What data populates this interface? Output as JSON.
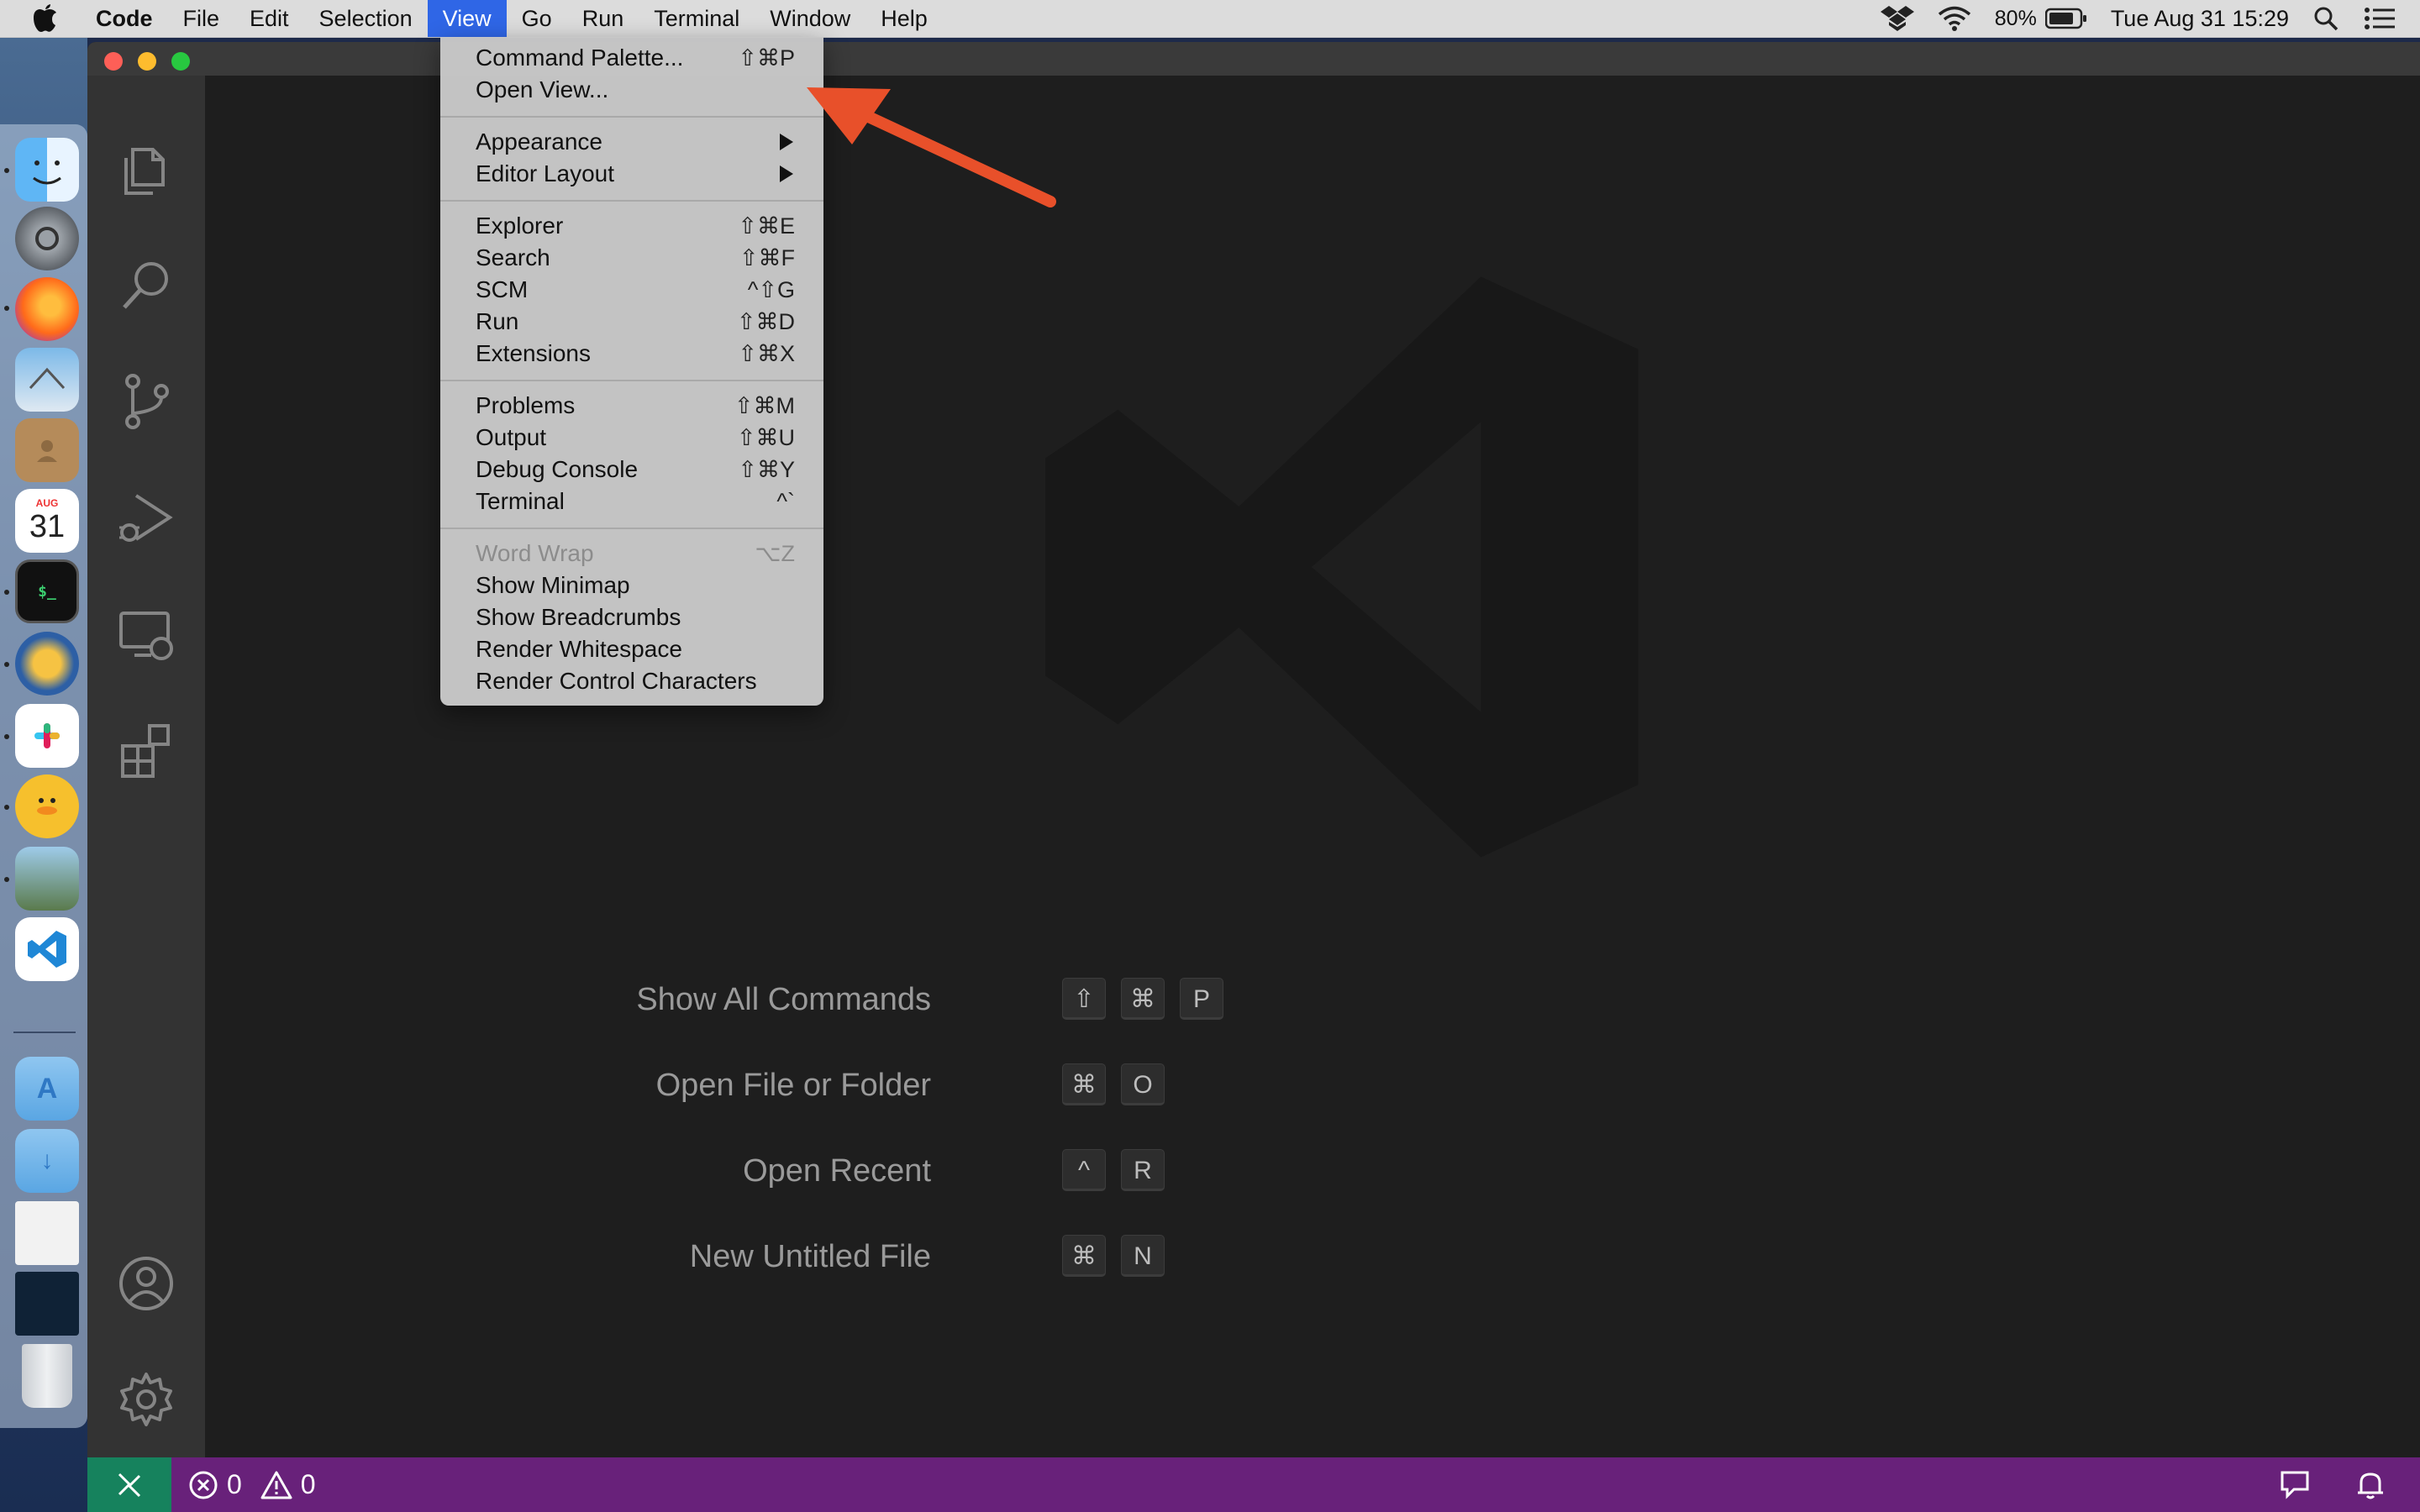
{
  "menubar": {
    "app_name": "Code",
    "items": [
      "File",
      "Edit",
      "Selection",
      "View",
      "Go",
      "Run",
      "Terminal",
      "Window",
      "Help"
    ],
    "active_item": "View",
    "battery_percent": "80%",
    "clock": "Tue Aug 31  15:29"
  },
  "view_menu": {
    "items": [
      {
        "label": "Command Palette...",
        "shortcut": "⇧⌘P"
      },
      {
        "label": "Open View...",
        "shortcut": ""
      },
      {
        "label": "Appearance",
        "shortcut": "",
        "submenu": true
      },
      {
        "label": "Editor Layout",
        "shortcut": "",
        "submenu": true
      },
      {
        "label": "Explorer",
        "shortcut": "⇧⌘E"
      },
      {
        "label": "Search",
        "shortcut": "⇧⌘F"
      },
      {
        "label": "SCM",
        "shortcut": "^⇧G"
      },
      {
        "label": "Run",
        "shortcut": "⇧⌘D"
      },
      {
        "label": "Extensions",
        "shortcut": "⇧⌘X"
      },
      {
        "label": "Problems",
        "shortcut": "⇧⌘M"
      },
      {
        "label": "Output",
        "shortcut": "⇧⌘U"
      },
      {
        "label": "Debug Console",
        "shortcut": "⇧⌘Y"
      },
      {
        "label": "Terminal",
        "shortcut": "^`"
      },
      {
        "label": "Word Wrap",
        "shortcut": "⌥Z",
        "disabled": true
      },
      {
        "label": "Show Minimap",
        "shortcut": ""
      },
      {
        "label": "Show Breadcrumbs",
        "shortcut": ""
      },
      {
        "label": "Render Whitespace",
        "shortcut": ""
      },
      {
        "label": "Render Control Characters",
        "shortcut": ""
      }
    ]
  },
  "welcome_shortcuts": [
    {
      "label": "Show All Commands",
      "keys": [
        "⇧",
        "⌘",
        "P"
      ]
    },
    {
      "label": "Open File or Folder",
      "keys": [
        "⌘",
        "O"
      ]
    },
    {
      "label": "Open Recent",
      "keys": [
        "^",
        "R"
      ]
    },
    {
      "label": "New Untitled File",
      "keys": [
        "⌘",
        "N"
      ]
    }
  ],
  "statusbar": {
    "errors": "0",
    "warnings": "0"
  },
  "dock": {
    "calendar_month": "AUG",
    "calendar_day": "31"
  },
  "colors": {
    "statusbar": "#68217a",
    "remote_indicator": "#16825d",
    "menu_highlight": "#2f66e6",
    "annotation_arrow": "#e8502a"
  }
}
